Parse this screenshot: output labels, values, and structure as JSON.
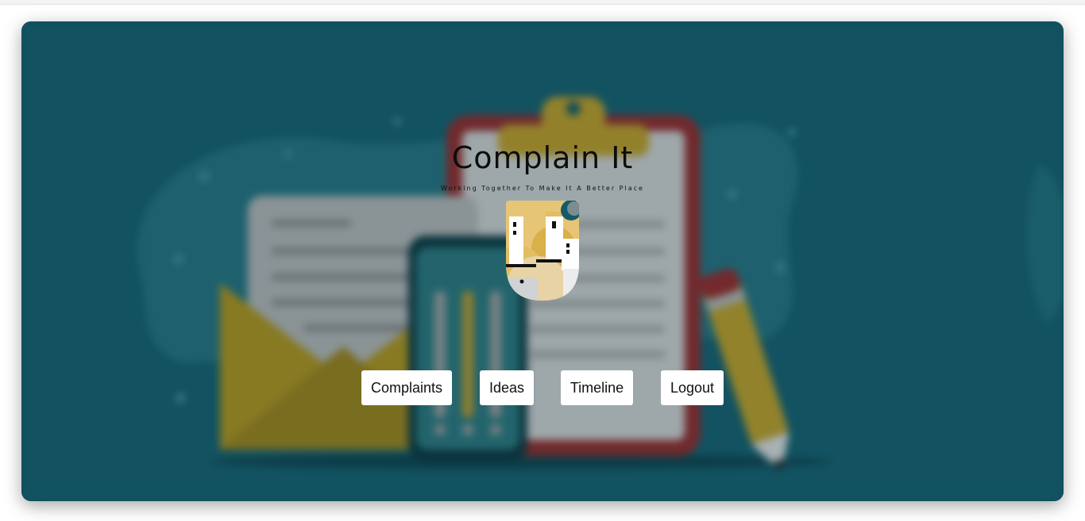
{
  "app": {
    "title": "Complain It",
    "tagline": "Working Together To Make It A Better Place"
  },
  "nav": {
    "items": [
      {
        "label": "Complaints"
      },
      {
        "label": "Ideas"
      },
      {
        "label": "Timeline"
      },
      {
        "label": "Logout"
      }
    ]
  },
  "colors": {
    "background": "#155a68",
    "button": "#ffffff",
    "logo_gold": "#d9b04a"
  },
  "icons": {
    "logo": "city-shield-logo",
    "background": "clipboard-envelope-phone-pencil-illustration"
  }
}
